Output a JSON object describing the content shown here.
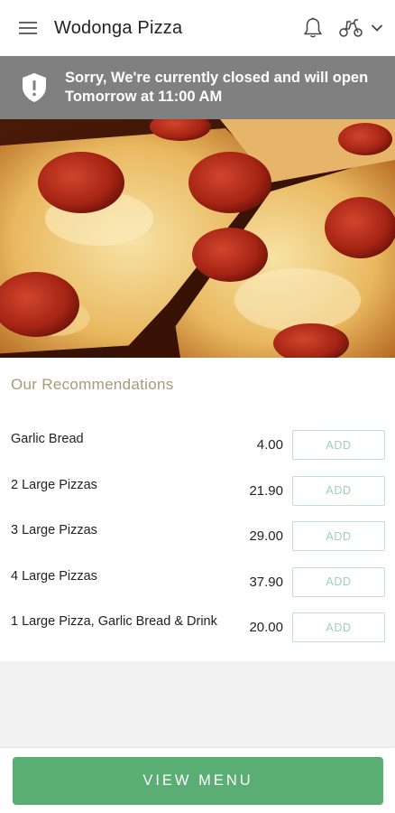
{
  "app_bar": {
    "title": "Wodonga Pizza",
    "menu_icon": "hamburger-menu-icon",
    "notification_icon": "bell-icon",
    "delivery_icon": "scooter-icon",
    "dropdown_icon": "chevron-down-icon"
  },
  "closed_banner": {
    "icon": "shield-alert-icon",
    "line1": "Sorry, We're currently closed and will open",
    "line2": "Tomorrow at 11:00 AM",
    "background": "#808080"
  },
  "hero": {
    "image": "pepperoni-pizza-photo"
  },
  "recommendations": {
    "title": "Our Recommendations",
    "items": [
      {
        "name": "Garlic Bread",
        "price": "4.00",
        "add_label": "ADD"
      },
      {
        "name": "2 Large Pizzas",
        "price": "21.90",
        "add_label": "ADD"
      },
      {
        "name": "3 Large Pizzas",
        "price": "29.00",
        "add_label": "ADD"
      },
      {
        "name": "4 Large Pizzas",
        "price": "37.90",
        "add_label": "ADD"
      },
      {
        "name": "1 Large Pizza, Garlic Bread & Drink",
        "price": "20.00",
        "add_label": "ADD"
      }
    ]
  },
  "footer": {
    "view_menu_label": "VIEW MENU"
  },
  "colors": {
    "accent_green": "#5aae73",
    "add_border": "#bfe0cc",
    "add_text": "#9ed0b3",
    "section_title": "#a79a78"
  }
}
